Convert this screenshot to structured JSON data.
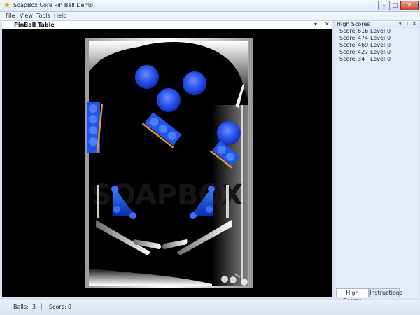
{
  "window": {
    "title": "SoapBox Core Pin Ball Demo",
    "app_icon": "star-icon"
  },
  "menu": [
    "File",
    "View",
    "Tools",
    "Help"
  ],
  "document": {
    "title": "PinBall Table"
  },
  "game": {
    "watermark": "SOAPBOX",
    "colors": {
      "bumper": "#1f4fe6",
      "target": "#1f55e8",
      "rail": "#e8952a",
      "frame": "#dcdcdc",
      "background": "#000000"
    }
  },
  "high_scores": {
    "title": "High Scores",
    "score_label": "Score:",
    "level_label": "Level:",
    "entries": [
      {
        "score": "616",
        "level": "0"
      },
      {
        "score": "474",
        "level": "0"
      },
      {
        "score": "469",
        "level": "0"
      },
      {
        "score": "427",
        "level": "0"
      },
      {
        "score": "34",
        "level": "0"
      }
    ]
  },
  "panel_tabs": [
    "High Scores",
    "Instructions"
  ],
  "status": {
    "balls_label": "Balls:",
    "balls": "3",
    "score_label": "Score:",
    "score": "0"
  }
}
